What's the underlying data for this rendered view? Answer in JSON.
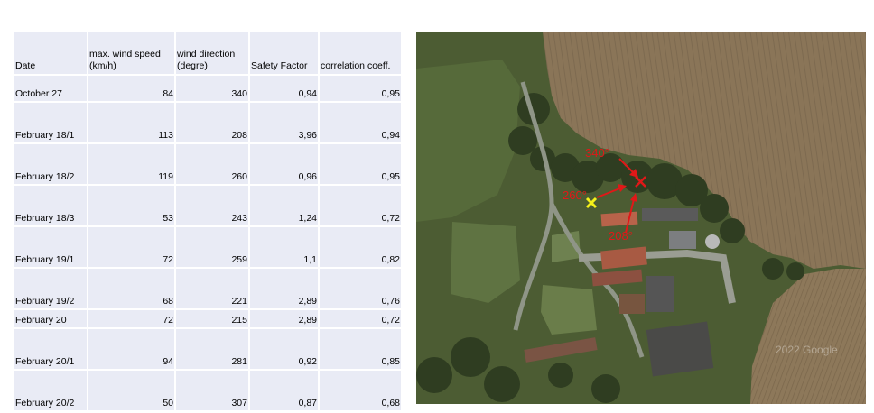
{
  "table": {
    "headers": {
      "date": "Date",
      "speed_line1": "max. wind speed",
      "speed_line2": "(km/h)",
      "direction_line1": "wind direction",
      "direction_line2": "(degre)",
      "safety": "Safety Factor",
      "correlation": "correlation coeff."
    },
    "rows": [
      {
        "date": "October 27",
        "speed": "84",
        "direction": "340",
        "safety": "0,94",
        "corr": "0,95"
      },
      {
        "date": "February 18/1",
        "speed": "113",
        "direction": "208",
        "safety": "3,96",
        "corr": "0,94"
      },
      {
        "date": "February 18/2",
        "speed": "119",
        "direction": "260",
        "safety": "0,96",
        "corr": "0,95"
      },
      {
        "date": "February 18/3",
        "speed": "53",
        "direction": "243",
        "safety": "1,24",
        "corr": "0,72"
      },
      {
        "date": "February 19/1",
        "speed": "72",
        "direction": "259",
        "safety": "1,1",
        "corr": "0,82"
      },
      {
        "date": "February 19/2",
        "speed": "68",
        "direction": "221",
        "safety": "2,89",
        "corr": "0,76"
      },
      {
        "date": "February 20",
        "speed": "72",
        "direction": "215",
        "safety": "2,89",
        "corr": "0,72"
      },
      {
        "date": "February 20/1",
        "speed": "94",
        "direction": "281",
        "safety": "0,92",
        "corr": "0,85"
      },
      {
        "date": "February 20/2",
        "speed": "50",
        "direction": "307",
        "safety": "0,87",
        "corr": "0,68"
      }
    ]
  },
  "map": {
    "label_340": "340°",
    "label_260": "260°",
    "label_208": "208°",
    "watermark": "2022 Google",
    "marker_color_red": "#e01818",
    "marker_color_yellow": "#f5f01a"
  }
}
